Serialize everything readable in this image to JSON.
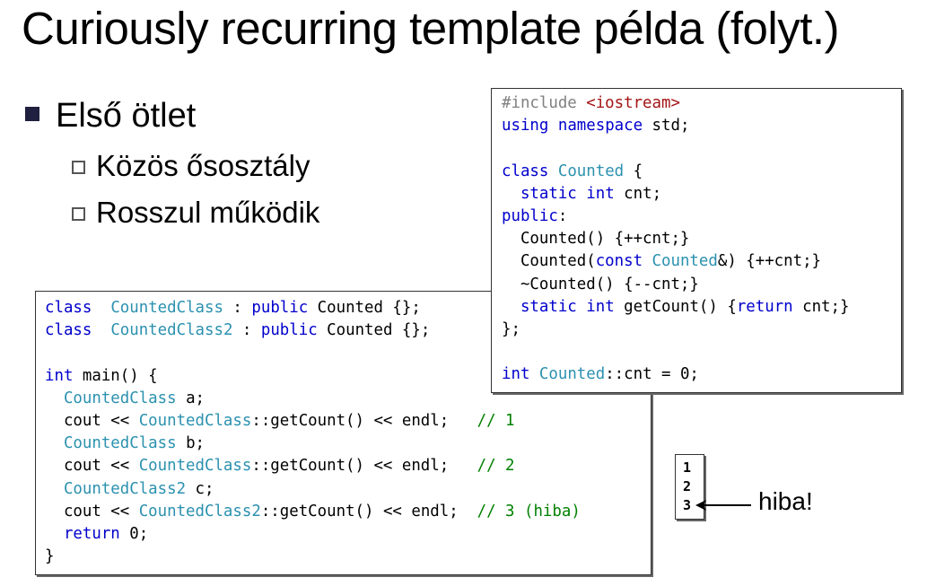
{
  "title": "Curiously recurring template példa (folyt.)",
  "bullets": {
    "level1": "Első ötlet",
    "level2": [
      "Közös ősosztály",
      "Rosszul működik"
    ]
  },
  "code_main": [
    [
      [
        "kw",
        "class"
      ],
      [
        "",
        "  "
      ],
      [
        "ty",
        "CountedClass"
      ],
      [
        "",
        " : "
      ],
      [
        "kw",
        "public"
      ],
      [
        "",
        " Counted {};"
      ]
    ],
    [
      [
        "kw",
        "class"
      ],
      [
        "",
        "  "
      ],
      [
        "ty",
        "CountedClass2"
      ],
      [
        "",
        " : "
      ],
      [
        "kw",
        "public"
      ],
      [
        "",
        " Counted {};"
      ]
    ],
    [],
    [
      [
        "kw",
        "int"
      ],
      [
        "",
        " main() {"
      ]
    ],
    [
      [
        "",
        "  "
      ],
      [
        "ty",
        "CountedClass"
      ],
      [
        "",
        " a;"
      ]
    ],
    [
      [
        "",
        "  cout << "
      ],
      [
        "ty",
        "CountedClass"
      ],
      [
        "",
        "::getCount() << endl;   "
      ],
      [
        "cm",
        "// 1"
      ]
    ],
    [
      [
        "",
        "  "
      ],
      [
        "ty",
        "CountedClass"
      ],
      [
        "",
        " b;"
      ]
    ],
    [
      [
        "",
        "  cout << "
      ],
      [
        "ty",
        "CountedClass"
      ],
      [
        "",
        "::getCount() << endl;   "
      ],
      [
        "cm",
        "// 2"
      ]
    ],
    [
      [
        "",
        "  "
      ],
      [
        "ty",
        "CountedClass2"
      ],
      [
        "",
        " c;"
      ]
    ],
    [
      [
        "",
        "  cout << "
      ],
      [
        "ty",
        "CountedClass2"
      ],
      [
        "",
        "::getCount() << endl;  "
      ],
      [
        "cm",
        "// 3 (hiba)"
      ]
    ],
    [
      [
        "",
        "  "
      ],
      [
        "kw",
        "return"
      ],
      [
        "",
        " 0;"
      ]
    ],
    [
      [
        "",
        "}"
      ]
    ]
  ],
  "code_counted": [
    [
      [
        "pp",
        "#include "
      ],
      [
        "st",
        "<iostream>"
      ]
    ],
    [
      [
        "kw",
        "using"
      ],
      [
        "",
        " "
      ],
      [
        "kw",
        "namespace"
      ],
      [
        "",
        " std;"
      ]
    ],
    [],
    [
      [
        "kw",
        "class"
      ],
      [
        "",
        " "
      ],
      [
        "ty",
        "Counted"
      ],
      [
        "",
        " {"
      ]
    ],
    [
      [
        "",
        "  "
      ],
      [
        "kw",
        "static"
      ],
      [
        "",
        " "
      ],
      [
        "kw",
        "int"
      ],
      [
        "",
        " cnt;"
      ]
    ],
    [
      [
        "kw",
        "public"
      ],
      [
        "",
        ":"
      ]
    ],
    [
      [
        "",
        "  Counted() {++cnt;}"
      ]
    ],
    [
      [
        "",
        "  Counted("
      ],
      [
        "kw",
        "const"
      ],
      [
        "",
        " "
      ],
      [
        "ty",
        "Counted"
      ],
      [
        "",
        "&) {++cnt;}"
      ]
    ],
    [
      [
        "",
        "  ~Counted() {--cnt;}"
      ]
    ],
    [
      [
        "",
        "  "
      ],
      [
        "kw",
        "static"
      ],
      [
        "",
        " "
      ],
      [
        "kw",
        "int"
      ],
      [
        "",
        " getCount() {"
      ],
      [
        "kw",
        "return"
      ],
      [
        "",
        " cnt;}"
      ]
    ],
    [
      [
        "",
        "};"
      ]
    ],
    [],
    [
      [
        "kw",
        "int"
      ],
      [
        "",
        " "
      ],
      [
        "ty",
        "Counted"
      ],
      [
        "",
        "::cnt = 0;"
      ]
    ]
  ],
  "output_lines": [
    "1",
    "2",
    "3"
  ],
  "error_label": "hiba!"
}
